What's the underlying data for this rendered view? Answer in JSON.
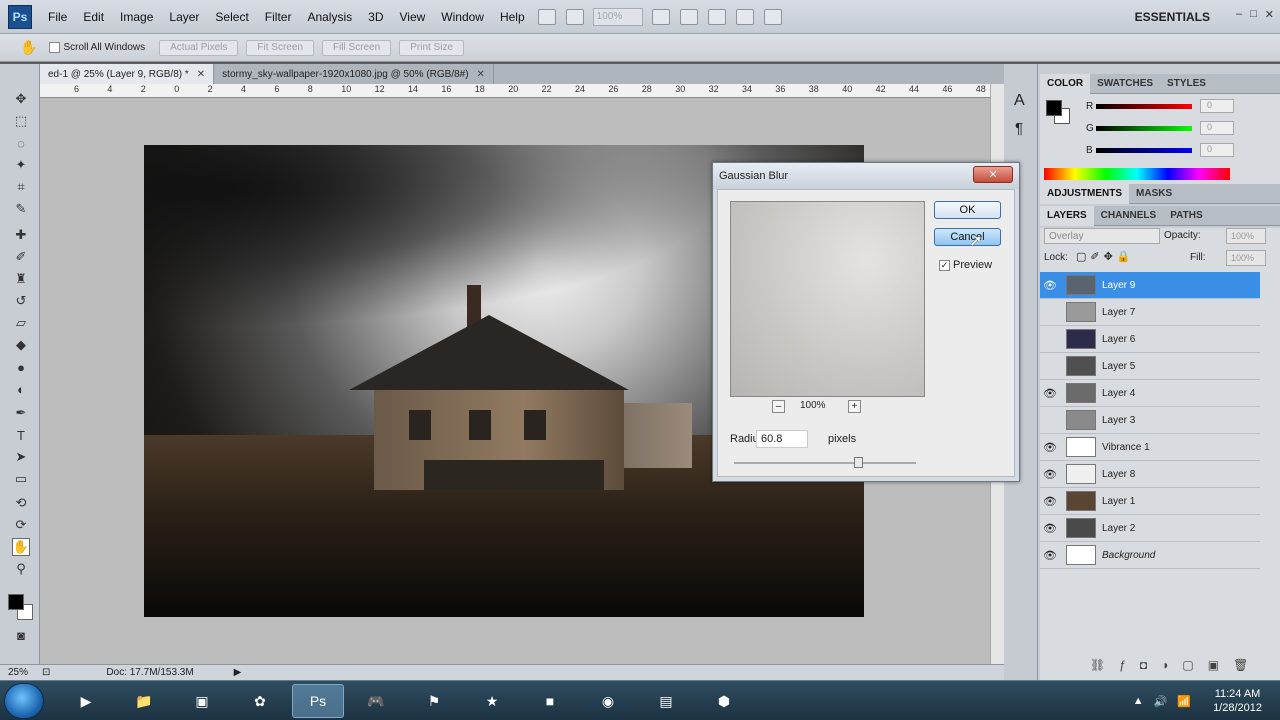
{
  "app": {
    "logo": "Ps",
    "menu": [
      "File",
      "Edit",
      "Image",
      "Layer",
      "Select",
      "Filter",
      "Analysis",
      "3D",
      "View",
      "Window",
      "Help"
    ],
    "zoom_display": "100%",
    "workspace": "ESSENTIALS",
    "window_controls": [
      "–",
      "□",
      "✕"
    ]
  },
  "options_bar": {
    "scroll_all_label": "Scroll All Windows",
    "buttons": [
      "Actual Pixels",
      "Fit Screen",
      "Fill Screen",
      "Print Size"
    ]
  },
  "document": {
    "tabs": [
      {
        "label": "ed-1 @ 25% (Layer 9, RGB/8) *",
        "active": true
      },
      {
        "label": "stormy_sky-wallpaper-1920x1080.jpg @ 50% (RGB/8#)",
        "active": false
      }
    ],
    "ruler_labels": [
      "6",
      "4",
      "2",
      "0",
      "2",
      "4",
      "6",
      "8",
      "10",
      "12",
      "14",
      "16",
      "18",
      "20",
      "22",
      "24",
      "26",
      "28",
      "30",
      "32",
      "34",
      "36",
      "38",
      "40",
      "42",
      "44",
      "46",
      "48"
    ],
    "zoom": "25%",
    "doc_info": "Doc: 17.7M/153.3M"
  },
  "color_panel": {
    "tabs": [
      "COLOR",
      "SWATCHES",
      "STYLES"
    ],
    "channels": [
      {
        "letter": "R",
        "value": "0",
        "color": "#d21818"
      },
      {
        "letter": "G",
        "value": "0",
        "color": "#21b021"
      },
      {
        "letter": "B",
        "value": "0",
        "color": "#1f44d6"
      }
    ]
  },
  "adjustments_tabs": [
    "ADJUSTMENTS",
    "MASKS"
  ],
  "layers_panel": {
    "tabs": [
      "LAYERS",
      "CHANNELS",
      "PATHS"
    ],
    "blend_mode": "Overlay",
    "opacity_label": "Opacity:",
    "opacity": "100%",
    "lock_label": "Lock:",
    "fill_label": "Fill:",
    "fill": "100%",
    "layers": [
      {
        "name": "Layer 9",
        "visible": true,
        "selected": true,
        "thumb": "#5a6470"
      },
      {
        "name": "Layer 7",
        "visible": false,
        "selected": false,
        "thumb": "#9a9a9a"
      },
      {
        "name": "Layer 6",
        "visible": false,
        "selected": false,
        "thumb": "#2c2b4a"
      },
      {
        "name": "Layer 5",
        "visible": false,
        "selected": false,
        "thumb": "#505050"
      },
      {
        "name": "Layer 4",
        "visible": true,
        "selected": false,
        "thumb": "#6b6b6b"
      },
      {
        "name": "Layer 3",
        "visible": false,
        "selected": false,
        "thumb": "#8a8a8a"
      },
      {
        "name": "Vibrance 1",
        "visible": true,
        "selected": false,
        "thumb": "#ffffff"
      },
      {
        "name": "Layer 8",
        "visible": true,
        "selected": false,
        "thumb": "#f0f0f0"
      },
      {
        "name": "Layer 1",
        "visible": true,
        "selected": false,
        "thumb": "#5a4533"
      },
      {
        "name": "Layer 2",
        "visible": true,
        "selected": false,
        "thumb": "#4a4a4a"
      },
      {
        "name": "Background",
        "visible": true,
        "selected": false,
        "thumb": "#ffffff"
      }
    ]
  },
  "dialog": {
    "title": "Gaussian Blur",
    "close": "✕",
    "ok_label": "OK",
    "cancel_label": "Cancel",
    "preview_label": "Preview",
    "preview_checked": true,
    "zoom": "100%",
    "zoom_minus": "–",
    "zoom_plus": "+",
    "radius_label": "Radius:",
    "radius_value": "60.8",
    "radius_unit": "pixels"
  },
  "taskbar": {
    "icons": [
      "▶",
      "📁",
      "▣",
      "✿",
      "Ps",
      "🎮",
      "⚑",
      "★",
      "■",
      "◉",
      "▤",
      "⬢"
    ],
    "clock_time": "11:24 AM",
    "clock_date": "1/28/2012"
  }
}
